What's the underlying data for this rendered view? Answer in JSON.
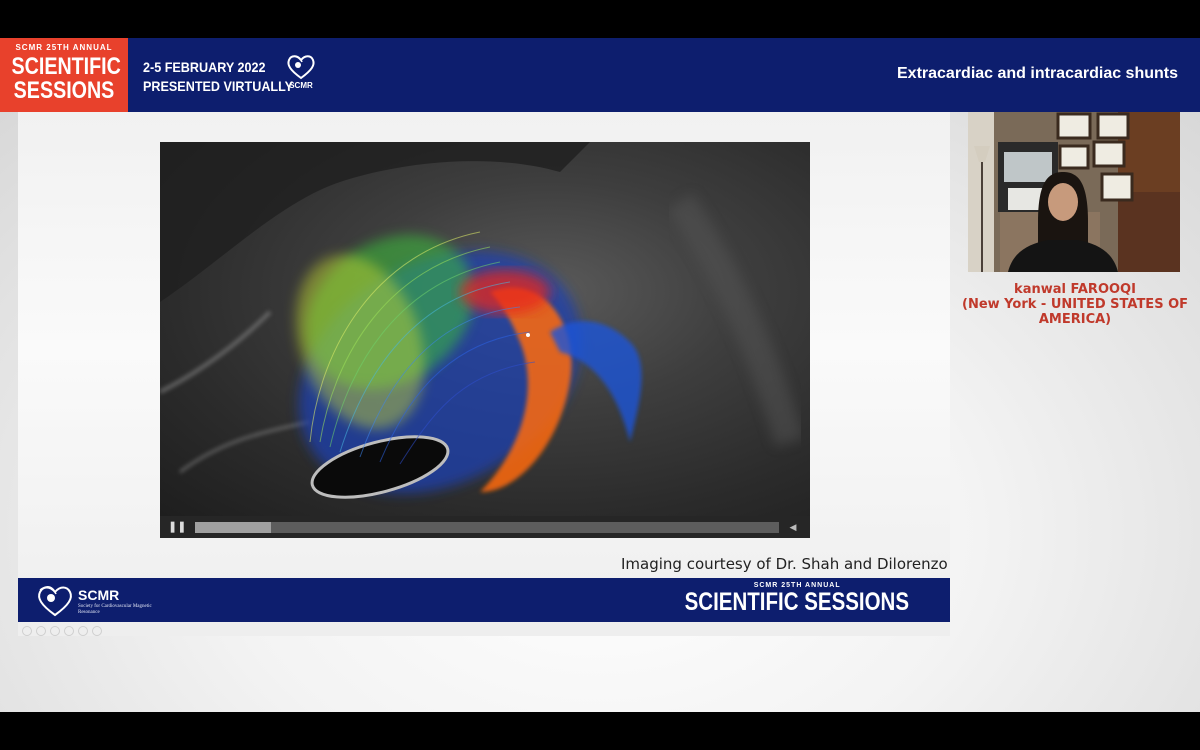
{
  "header": {
    "brand_top": "SCMR 25TH ANNUAL",
    "brand_line1": "SCIENTIFIC",
    "brand_line2": "SESSIONS",
    "dates_line1": "2-5 FEBRUARY 2022",
    "dates_line2": "PRESENTED VIRTUALLY",
    "logo_label": "SCMR",
    "session_title": "Extracardiac and intracardiac shunts"
  },
  "slide": {
    "caption": "Imaging courtesy of Dr. Shah and Dilorenzo",
    "footer_logo_name": "SCMR",
    "footer_logo_subtitle": "Society for Cardiovascular Magnetic Resonance",
    "footer_title_top": "SCMR 25TH ANNUAL",
    "footer_title_main": "SCIENTIFIC SESSIONS",
    "dot_count": 6
  },
  "player": {
    "state": "playing",
    "pause_icon": "pause-icon",
    "volume_icon": "volume-icon",
    "progress_fraction": 0.13
  },
  "speaker": {
    "name_line1": "kanwal FAROOQI",
    "name_line2": "(New York - UNITED STATES OF",
    "name_line3": "AMERICA)"
  },
  "colors": {
    "header_navy": "#0d1e6e",
    "brand_red": "#e8412c",
    "speaker_name": "#c0392b"
  }
}
